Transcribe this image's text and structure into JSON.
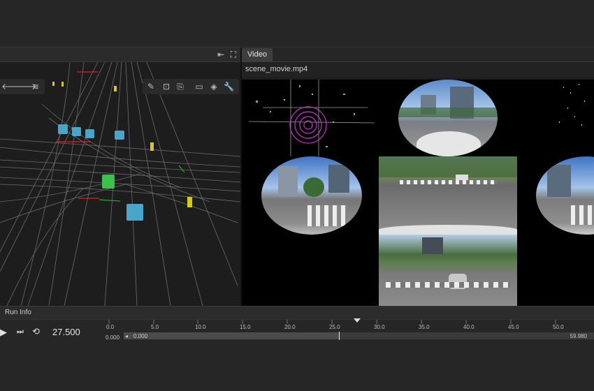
{
  "left_panel": {
    "header_icons": [
      "collapse-left-icon",
      "fullscreen-icon"
    ],
    "toolbar_left": [
      "arrow-left-icon",
      "arrow-right-icon",
      "trajectory-icon"
    ],
    "toolbar_right": [
      "ruler-icon",
      "focus-icon",
      "camera-follow-icon",
      "video-camera-icon",
      "layers-icon",
      "wrench-icon"
    ]
  },
  "right_panel": {
    "tab_label": "Video",
    "file_name": "scene_movie.mp4"
  },
  "run_info": {
    "label": "Run Info"
  },
  "playback": {
    "current_time": "27.500",
    "range_start": "0.000",
    "range_start_field": "0.000",
    "range_end": "59.980",
    "progress": 0.458,
    "tick_labels": [
      "0.0",
      "5.0",
      "10.0",
      "15.0",
      "20.0",
      "25.0",
      "30.0",
      "35.0",
      "40.0",
      "45.0",
      "50.0"
    ]
  },
  "colors": {
    "vehicle": "#4aa6c8",
    "ego": "#3cc24a",
    "pedestrian": "#d8c81e",
    "lidar": "#c13cc1"
  }
}
